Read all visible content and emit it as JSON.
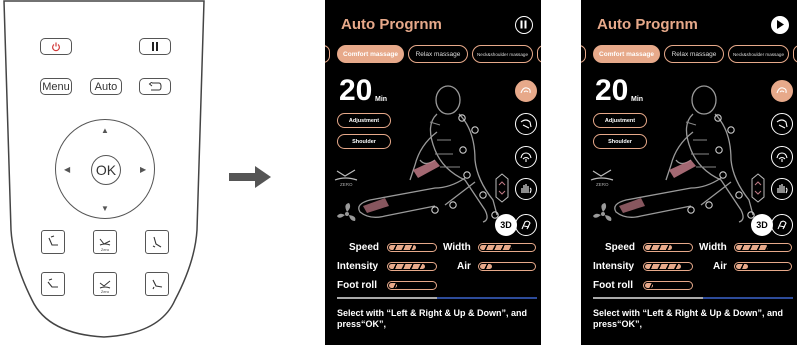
{
  "remote": {
    "menu_label": "Menu",
    "auto_label": "Auto",
    "ok_label": "OK",
    "zero_label": "Zero"
  },
  "screens": [
    {
      "title": "Auto Progrnm",
      "control": "pause",
      "tabs": [
        "Comfort massage",
        "Relax massage",
        "Neck&shoulder massage"
      ],
      "active_tab": 0,
      "time_value": "20",
      "time_unit": "Min",
      "buttons": [
        "Adjustment",
        "Shoulder"
      ],
      "zero_label": "ZERO",
      "three_d_label": "3D",
      "settings": [
        {
          "label": "Speed",
          "level": 0.6
        },
        {
          "label": "Width",
          "level": 0.6
        },
        {
          "label": "Intensity",
          "level": 0.8
        },
        {
          "label": "Air",
          "level": 0.25
        },
        {
          "label": "Foot roll",
          "level": 0.2
        }
      ],
      "progress": 0.5,
      "instruction": "Select with “Left & Right & Up & Down”, and press“OK”,"
    },
    {
      "title": "Auto Progrnm",
      "control": "play",
      "tabs": [
        "Comfort massage",
        "Relax massage",
        "Neck&shoulder massage"
      ],
      "active_tab": 0,
      "time_value": "20",
      "time_unit": "Min",
      "buttons": [
        "Adjustment",
        "Shoulder"
      ],
      "zero_label": "ZERO",
      "three_d_label": "3D",
      "settings": [
        {
          "label": "Speed",
          "level": 0.6
        },
        {
          "label": "Width",
          "level": 0.6
        },
        {
          "label": "Intensity",
          "level": 0.8
        },
        {
          "label": "Air",
          "level": 0.25
        },
        {
          "label": "Foot roll",
          "level": 0.2
        }
      ],
      "progress": 0.55,
      "instruction": "Select with “Left & Right & Up & Down”, and press“OK”,"
    }
  ],
  "colors": {
    "accent": "#e7a98a",
    "panel_bg": "#000000",
    "progress_blue": "#2d4b9a",
    "power_red": "#d23a3a"
  }
}
